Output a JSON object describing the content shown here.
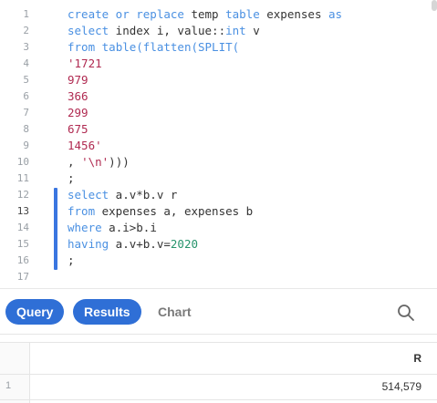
{
  "editor": {
    "line_numbers": [
      "1",
      "2",
      "3",
      "4",
      "5",
      "6",
      "7",
      "8",
      "9",
      "10",
      "11",
      "12",
      "13",
      "14",
      "15",
      "16",
      "17"
    ],
    "lines": [
      [
        {
          "t": "create or replace",
          "c": "kw"
        },
        {
          "t": " temp ",
          "c": ""
        },
        {
          "t": "table",
          "c": "kw"
        },
        {
          "t": " expenses ",
          "c": ""
        },
        {
          "t": "as",
          "c": "kw"
        }
      ],
      [
        {
          "t": "select",
          "c": "kw"
        },
        {
          "t": " index i, value::",
          "c": ""
        },
        {
          "t": "int",
          "c": "kw"
        },
        {
          "t": " v",
          "c": ""
        }
      ],
      [
        {
          "t": "from",
          "c": "kw"
        },
        {
          "t": " ",
          "c": ""
        },
        {
          "t": "table(flatten(SPLIT(",
          "c": "kw"
        }
      ],
      [
        {
          "t": "'1721",
          "c": "str"
        }
      ],
      [
        {
          "t": "979",
          "c": "str"
        }
      ],
      [
        {
          "t": "366",
          "c": "str"
        }
      ],
      [
        {
          "t": "299",
          "c": "str"
        }
      ],
      [
        {
          "t": "675",
          "c": "str"
        }
      ],
      [
        {
          "t": "1456'",
          "c": "str"
        }
      ],
      [
        {
          "t": ", ",
          "c": ""
        },
        {
          "t": "'\\n'",
          "c": "str"
        },
        {
          "t": ")))",
          "c": ""
        }
      ],
      [
        {
          "t": ";",
          "c": ""
        }
      ],
      [
        {
          "t": "select",
          "c": "kw"
        },
        {
          "t": " a.v*b.v r",
          "c": ""
        }
      ],
      [
        {
          "t": "from",
          "c": "kw"
        },
        {
          "t": " expenses a, expenses b",
          "c": ""
        }
      ],
      [
        {
          "t": "where",
          "c": "kw"
        },
        {
          "t": " a.i>b.i",
          "c": ""
        }
      ],
      [
        {
          "t": "having",
          "c": "kw"
        },
        {
          "t": " a.v+b.v=",
          "c": ""
        },
        {
          "t": "2020",
          "c": "num"
        }
      ],
      [
        {
          "t": ";",
          "c": ""
        }
      ],
      []
    ],
    "active_line": 13
  },
  "tabs": {
    "query": "Query",
    "results": "Results",
    "chart": "Chart"
  },
  "results": {
    "columns": [
      "R"
    ],
    "rows": [
      {
        "num": "1",
        "values": [
          "514,579"
        ]
      }
    ]
  }
}
